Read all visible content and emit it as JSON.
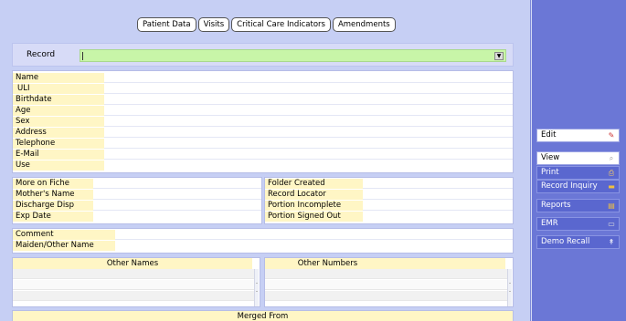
{
  "tabs": [
    "Patient Data",
    "Visits",
    "Critical Care Indicators",
    "Amendments"
  ],
  "record": {
    "label": "Record",
    "value": ""
  },
  "demographics": [
    "Name",
    "ULI",
    "Birthdate",
    "Age",
    "Sex",
    "Address",
    "Telephone",
    "E-Mail",
    "Use"
  ],
  "fiche_left": [
    "More on Fiche",
    "Mother's Name",
    "Discharge Disp",
    "Exp Date"
  ],
  "fiche_right": [
    "Folder Created",
    "Record Locator",
    "Portion Incomplete",
    "Portion Signed Out"
  ],
  "comments": [
    "Comment",
    "Maiden/Other Name"
  ],
  "other_names": {
    "header": "Other Names"
  },
  "other_numbers": {
    "header": "Other Numbers"
  },
  "merged": {
    "header": "Merged From"
  },
  "side_menu": {
    "edit": "Edit",
    "view": "View",
    "print": "Print",
    "record_inquiry": "Record Inquiry",
    "reports": "Reports",
    "emr": "EMR",
    "demo_recall": "Demo Recall"
  },
  "icons": {
    "edit": "pencil-icon",
    "view": "magnifier-icon",
    "print": "printer-icon",
    "record_inquiry": "folder-icon",
    "reports": "report-icon",
    "emr": "document-icon",
    "demo_recall": "pin-icon"
  },
  "colors": {
    "record_field": "#c8f5a8",
    "label_bg": "#fff6c5",
    "sidebar": "#6b77d6",
    "content_bg": "#c6cff4"
  }
}
